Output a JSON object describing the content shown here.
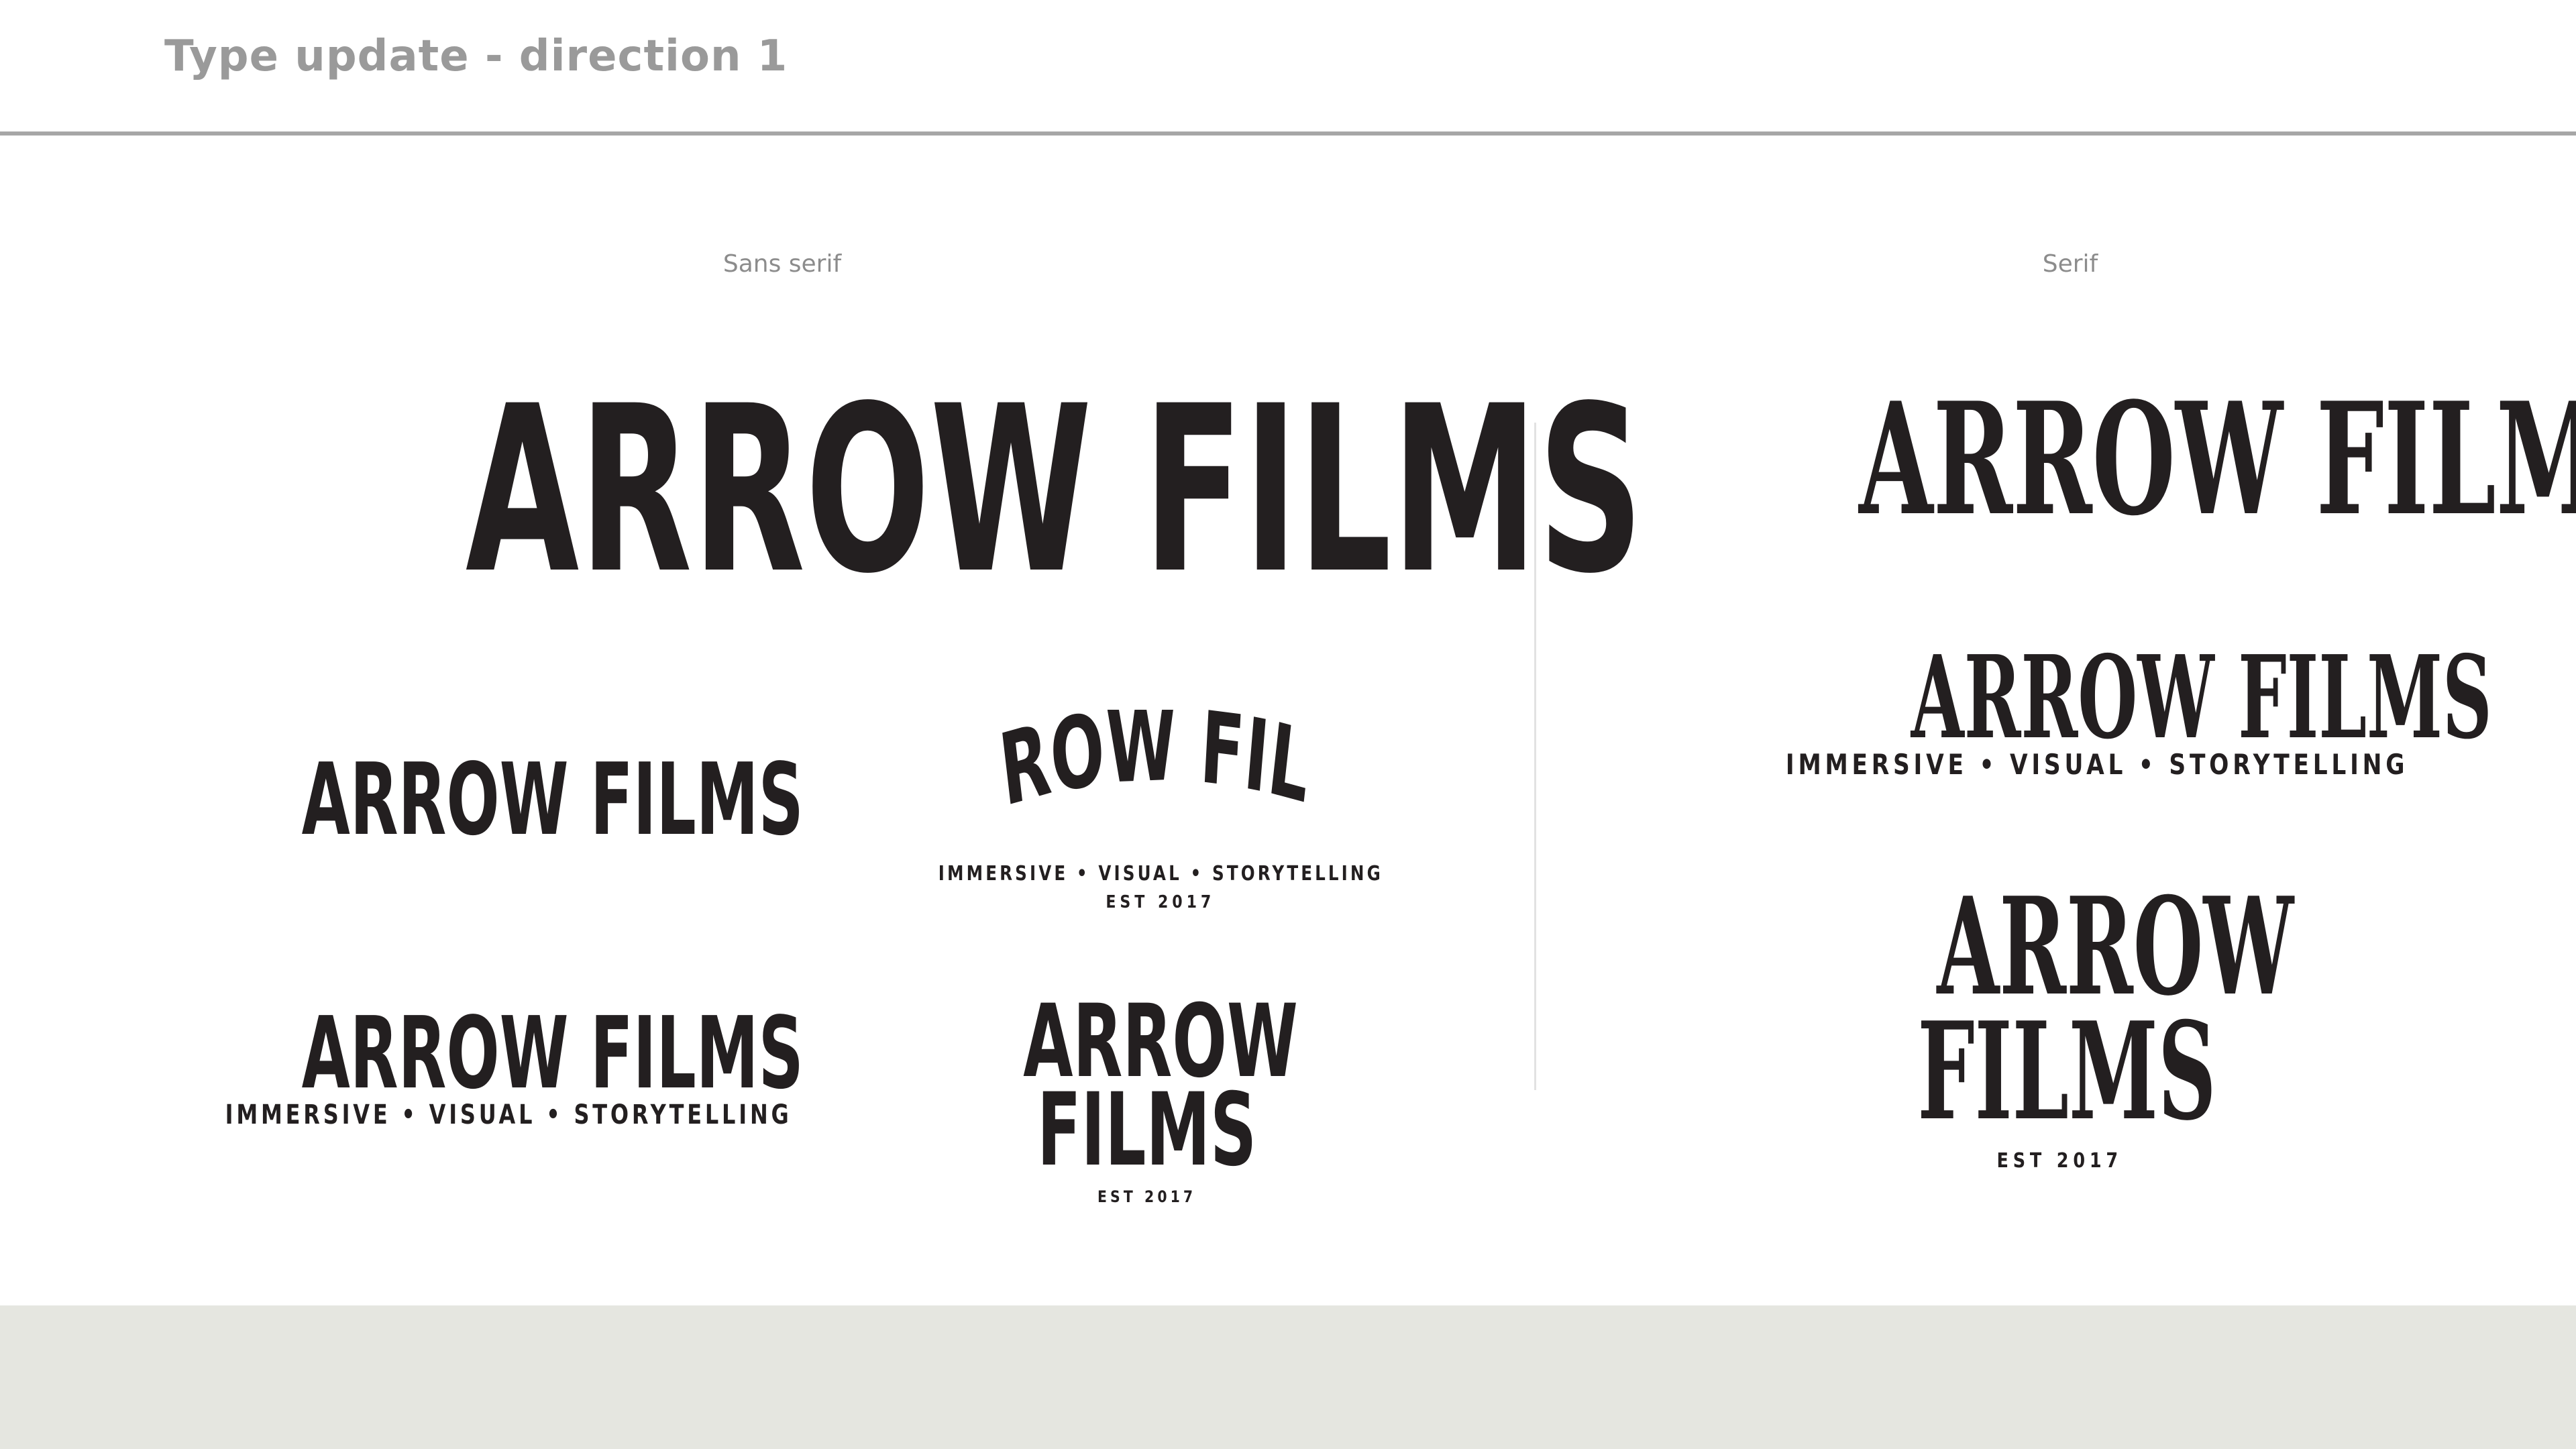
{
  "header": {
    "title": "Type update - direction 1"
  },
  "sections": {
    "sans_label": "Sans serif",
    "serif_label": "Serif"
  },
  "logos": {
    "sans_large": {
      "wordmark": "ARROW FILMS"
    },
    "sans_simple": {
      "wordmark": "ARROW FILMS"
    },
    "sans_arched": {
      "wordmark": "ARROW FILMS",
      "tagline": "IMMERSIVE • VISUAL • STORYTELLING",
      "est": "EST 2017"
    },
    "sans_tagline": {
      "wordmark": "ARROW FILMS",
      "tagline": "IMMERSIVE • VISUAL • STORYTELLING"
    },
    "sans_stacked": {
      "line1": "ARROW",
      "line2": "FILMS",
      "est": "EST 2017"
    },
    "serif_main": {
      "wordmark": "ARROW FILMS"
    },
    "serif_tagline": {
      "wordmark": "ARROW FILMS",
      "tagline": "IMMERSIVE • VISUAL • STORYTELLING"
    },
    "serif_stacked": {
      "line1": "ARROW",
      "line2": "FILMS",
      "est": "EST 2017"
    }
  },
  "colors": {
    "ink": "#231f20",
    "header_text": "#9a9a9a",
    "rule": "#a6a6a6",
    "footer": "#e5e6e0"
  }
}
